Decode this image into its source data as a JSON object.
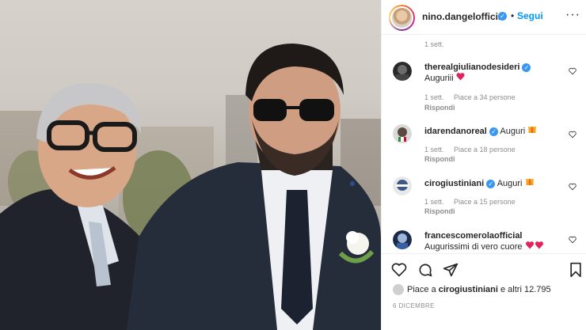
{
  "post": {
    "author": "nino.dangelofficial",
    "dot": "•",
    "follow_label": "Segui",
    "more_label": "···",
    "date": "6 DICEMBRE"
  },
  "top_time": "1 sett.",
  "comments": [
    {
      "user": "therealgiulianodesideri",
      "text": "Auguriii",
      "emoji": "heart",
      "time": "1 sett.",
      "likes": "Piace a 34 persone",
      "reply": "Rispondi"
    },
    {
      "user": "idarendanoreal",
      "text": "Auguri",
      "emoji": "gift",
      "time": "1 sett.",
      "likes": "Piace a 18 persone",
      "reply": "Rispondi"
    },
    {
      "user": "cirogiustiniani",
      "text": "Auguri",
      "emoji": "gift",
      "time": "1 sett.",
      "likes": "Piace a 15 persone",
      "reply": "Rispondi"
    },
    {
      "user": "francescomerolaofficial",
      "text": "Augurissimi di vero cuore",
      "emoji": "two-hearts"
    }
  ],
  "likes_summary": {
    "prefix": "Piace a ",
    "user": "cirogiustiniani",
    "suffix": " e altri 12.795"
  },
  "colors": {
    "accent": "#0095f6",
    "verified": "#3897f0",
    "muted": "#8e8e8e",
    "heart": "#ed4956"
  }
}
